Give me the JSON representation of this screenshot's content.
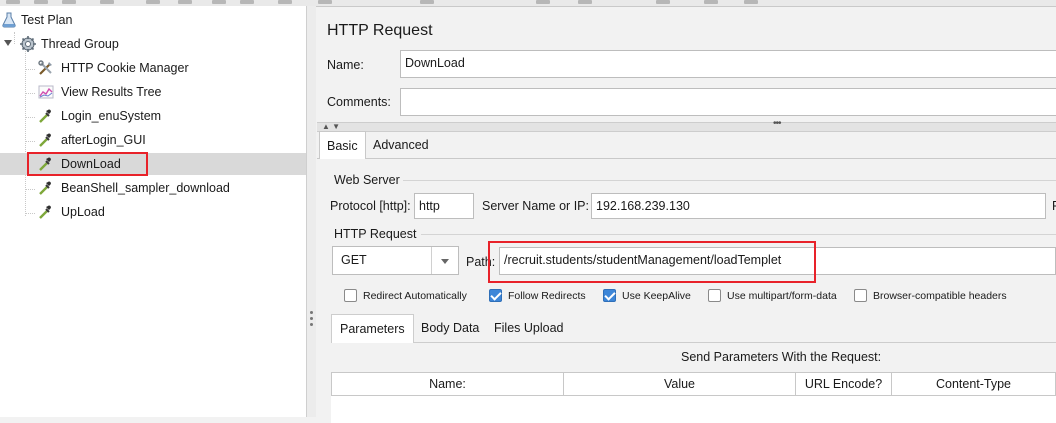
{
  "tree": {
    "items": [
      {
        "label": "Test Plan",
        "icon": "test-plan-icon"
      },
      {
        "label": "Thread Group",
        "icon": "gear-icon"
      },
      {
        "label": "HTTP Cookie Manager",
        "icon": "tools-icon"
      },
      {
        "label": "View Results Tree",
        "icon": "chart-icon"
      },
      {
        "label": "Login_enuSystem",
        "icon": "pipette-icon"
      },
      {
        "label": "afterLogin_GUI",
        "icon": "pipette-icon"
      },
      {
        "label": "DownLoad",
        "icon": "pipette-icon"
      },
      {
        "label": "BeanShell_sampler_download",
        "icon": "pipette-icon"
      },
      {
        "label": "UpLoad",
        "icon": "pipette-icon"
      }
    ],
    "selected": "DownLoad"
  },
  "panel": {
    "title": "HTTP Request",
    "name_label": "Name:",
    "name_value": "DownLoad",
    "comments_label": "Comments:",
    "comments_value": "",
    "tabs": [
      "Basic",
      "Advanced"
    ],
    "web_server": {
      "title": "Web Server",
      "protocol_label": "Protocol [http]:",
      "protocol_value": "http",
      "server_label": "Server Name or IP:",
      "server_value": "192.168.239.130",
      "port_label_cut": "F"
    },
    "http_request": {
      "title": "HTTP Request",
      "method": "GET",
      "path_label": "Path:",
      "path_value": "/recruit.students/studentManagement/loadTemplet"
    },
    "checkboxes": [
      {
        "label": "Redirect Automatically",
        "checked": false
      },
      {
        "label": "Follow Redirects",
        "checked": true
      },
      {
        "label": "Use KeepAlive",
        "checked": true
      },
      {
        "label": "Use multipart/form-data",
        "checked": false
      },
      {
        "label": "Browser-compatible headers",
        "checked": false
      }
    ],
    "subtabs": [
      "Parameters",
      "Body Data",
      "Files Upload"
    ],
    "table_caption": "Send Parameters With the Request:",
    "columns": [
      "Name:",
      "Value",
      "URL Encode?",
      "Content-Type"
    ]
  },
  "colors": {
    "highlight": "#e8222a",
    "checkbox_checked": "#3d86d8",
    "selected_row": "#d9d9d9"
  }
}
